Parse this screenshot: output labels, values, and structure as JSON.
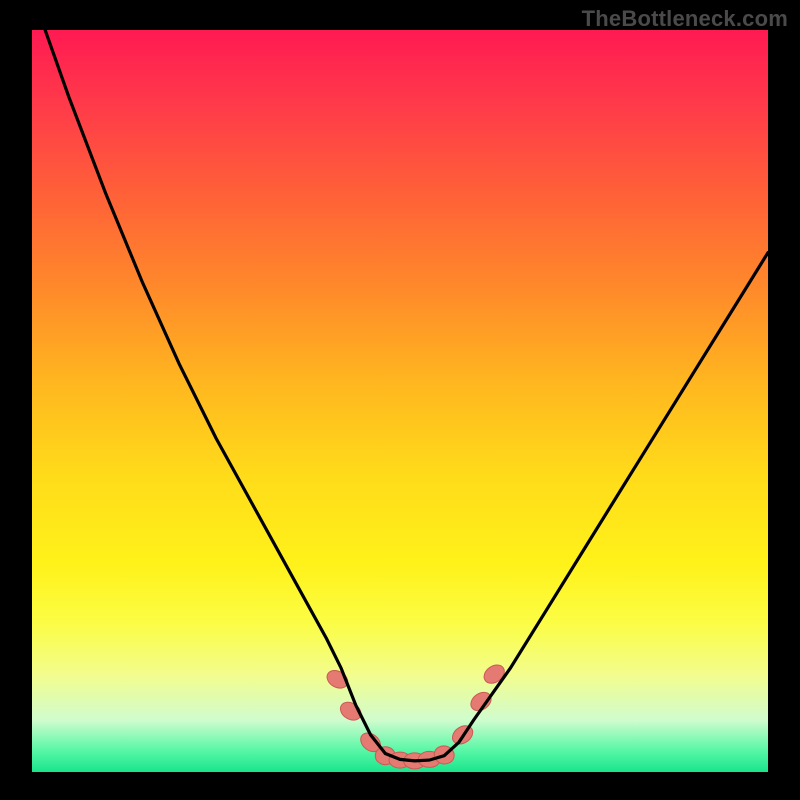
{
  "watermark": "TheBottleneck.com",
  "chart_data": {
    "type": "line",
    "title": "",
    "xlabel": "",
    "ylabel": "",
    "xlim": [
      0,
      100
    ],
    "ylim": [
      0,
      100
    ],
    "series": [
      {
        "name": "curve",
        "x": [
          0,
          5,
          10,
          15,
          20,
          25,
          30,
          35,
          40,
          42,
          44,
          46,
          48,
          50,
          52,
          54,
          56,
          58,
          60,
          65,
          70,
          75,
          80,
          85,
          90,
          95,
          100
        ],
        "values": [
          105,
          91,
          78,
          66,
          55,
          45,
          36,
          27,
          18,
          14,
          9,
          5,
          2.5,
          1.7,
          1.5,
          1.6,
          2.2,
          4,
          7,
          14,
          22,
          30,
          38,
          46,
          54,
          62,
          70
        ]
      }
    ],
    "markers": {
      "color": "#e47a72",
      "stroke": "#c95b54",
      "points": [
        {
          "x": 41.5,
          "y": 12.5,
          "rx": 8,
          "ry": 11,
          "rot": -60
        },
        {
          "x": 43.3,
          "y": 8.2,
          "rx": 8,
          "ry": 11,
          "rot": -58
        },
        {
          "x": 46.0,
          "y": 4.0,
          "rx": 8,
          "ry": 11,
          "rot": -50
        },
        {
          "x": 48.0,
          "y": 2.2,
          "rx": 10,
          "ry": 9,
          "rot": 0
        },
        {
          "x": 50.0,
          "y": 1.6,
          "rx": 11,
          "ry": 8,
          "rot": 0
        },
        {
          "x": 52.0,
          "y": 1.5,
          "rx": 11,
          "ry": 8,
          "rot": 0
        },
        {
          "x": 54.0,
          "y": 1.7,
          "rx": 11,
          "ry": 8,
          "rot": 0
        },
        {
          "x": 56.0,
          "y": 2.3,
          "rx": 10,
          "ry": 9,
          "rot": 12
        },
        {
          "x": 58.5,
          "y": 5.0,
          "rx": 8,
          "ry": 11,
          "rot": 55
        },
        {
          "x": 61.0,
          "y": 9.5,
          "rx": 8,
          "ry": 11,
          "rot": 55
        },
        {
          "x": 62.8,
          "y": 13.2,
          "rx": 8,
          "ry": 11,
          "rot": 55
        }
      ]
    },
    "colors": {
      "background_top": "#ff1a52",
      "background_bottom": "#19e58c",
      "curve": "#000000",
      "marker_fill": "#e47a72"
    }
  }
}
